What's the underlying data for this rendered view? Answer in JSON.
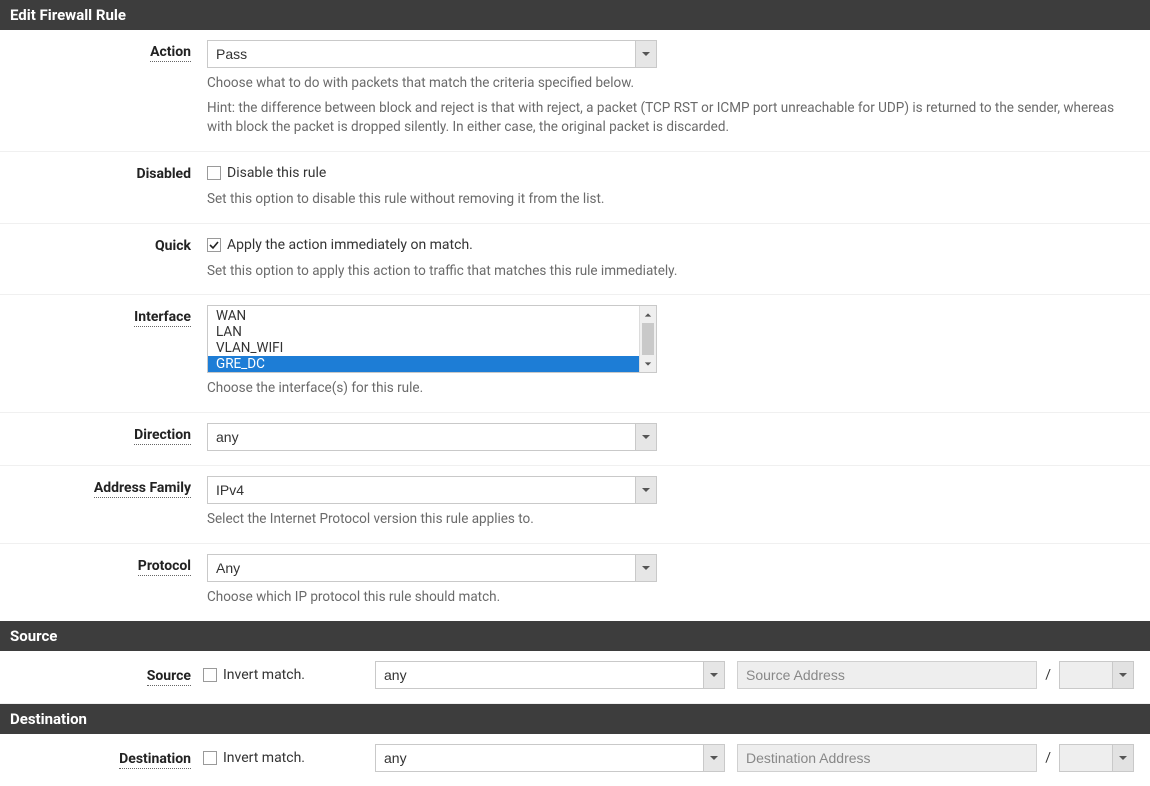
{
  "panel1": {
    "title": "Edit Firewall Rule"
  },
  "panel2": {
    "title": "Source"
  },
  "panel3": {
    "title": "Destination"
  },
  "action": {
    "label": "Action",
    "value": "Pass",
    "help1": "Choose what to do with packets that match the criteria specified below.",
    "help2": "Hint: the difference between block and reject is that with reject, a packet (TCP RST or ICMP port unreachable for UDP) is returned to the sender, whereas with block the packet is dropped silently. In either case, the original packet is discarded."
  },
  "disabled": {
    "label": "Disabled",
    "checkbox_label": "Disable this rule",
    "checked": false,
    "help": "Set this option to disable this rule without removing it from the list."
  },
  "quick": {
    "label": "Quick",
    "checkbox_label": "Apply the action immediately on match.",
    "checked": true,
    "help": "Set this option to apply this action to traffic that matches this rule immediately."
  },
  "interface": {
    "label": "Interface",
    "options": [
      "WAN",
      "LAN",
      "VLAN_WIFI",
      "GRE_DC"
    ],
    "selected": [
      "GRE_DC"
    ],
    "help": "Choose the interface(s) for this rule."
  },
  "direction": {
    "label": "Direction",
    "value": "any"
  },
  "address_family": {
    "label": "Address Family",
    "value": "IPv4",
    "help": "Select the Internet Protocol version this rule applies to."
  },
  "protocol": {
    "label": "Protocol",
    "value": "Any",
    "help": "Choose which IP protocol this rule should match."
  },
  "source": {
    "label": "Source",
    "invert_label": "Invert match.",
    "invert_checked": false,
    "type_value": "any",
    "address_placeholder": "Source Address",
    "address_value": "",
    "mask_value": ""
  },
  "destination": {
    "label": "Destination",
    "invert_label": "Invert match.",
    "invert_checked": false,
    "type_value": "any",
    "address_placeholder": "Destination Address",
    "address_value": "",
    "mask_value": ""
  },
  "slash": "/"
}
